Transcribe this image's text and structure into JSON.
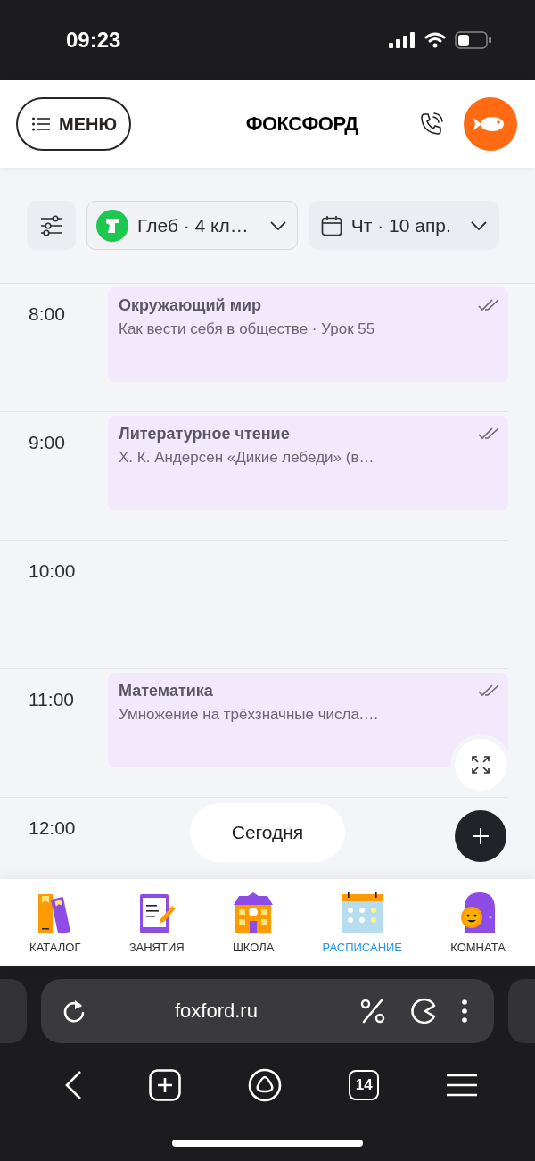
{
  "status_bar": {
    "time": "09:23"
  },
  "header": {
    "menu_label": "МЕНЮ",
    "logo": "ФОКСФОРД"
  },
  "filters": {
    "student": "Глеб · 4 кл…",
    "date": "Чт · 10 апр."
  },
  "schedule": [
    {
      "time": "8:00",
      "lesson": {
        "subject": "Окружающий мир",
        "topic": "Как вести себя в обществе · Урок 55",
        "done": true
      }
    },
    {
      "time": "9:00",
      "lesson": {
        "subject": "Литературное чтение",
        "topic": "Х. К. Андерсен «Дикие лебеди» (в…",
        "done": true
      }
    },
    {
      "time": "10:00"
    },
    {
      "time": "11:00",
      "lesson": {
        "subject": "Математика",
        "topic": "Умножение на трёхзначные числа.…",
        "done": true
      }
    },
    {
      "time": "12:00"
    }
  ],
  "today_button": "Сегодня",
  "bottom_nav": [
    {
      "kind": "catalog",
      "label": "КАТАЛОГ",
      "selected": false
    },
    {
      "kind": "lessons",
      "label": "ЗАНЯТИЯ",
      "selected": false
    },
    {
      "kind": "school",
      "label": "ШКОЛА",
      "selected": false
    },
    {
      "kind": "schedule",
      "label": "РАСПИСАНИЕ",
      "selected": true
    },
    {
      "kind": "room",
      "label": "КОМНАТА",
      "selected": false
    }
  ],
  "browser": {
    "url": "foxford.ru",
    "tabs_count": "14"
  }
}
